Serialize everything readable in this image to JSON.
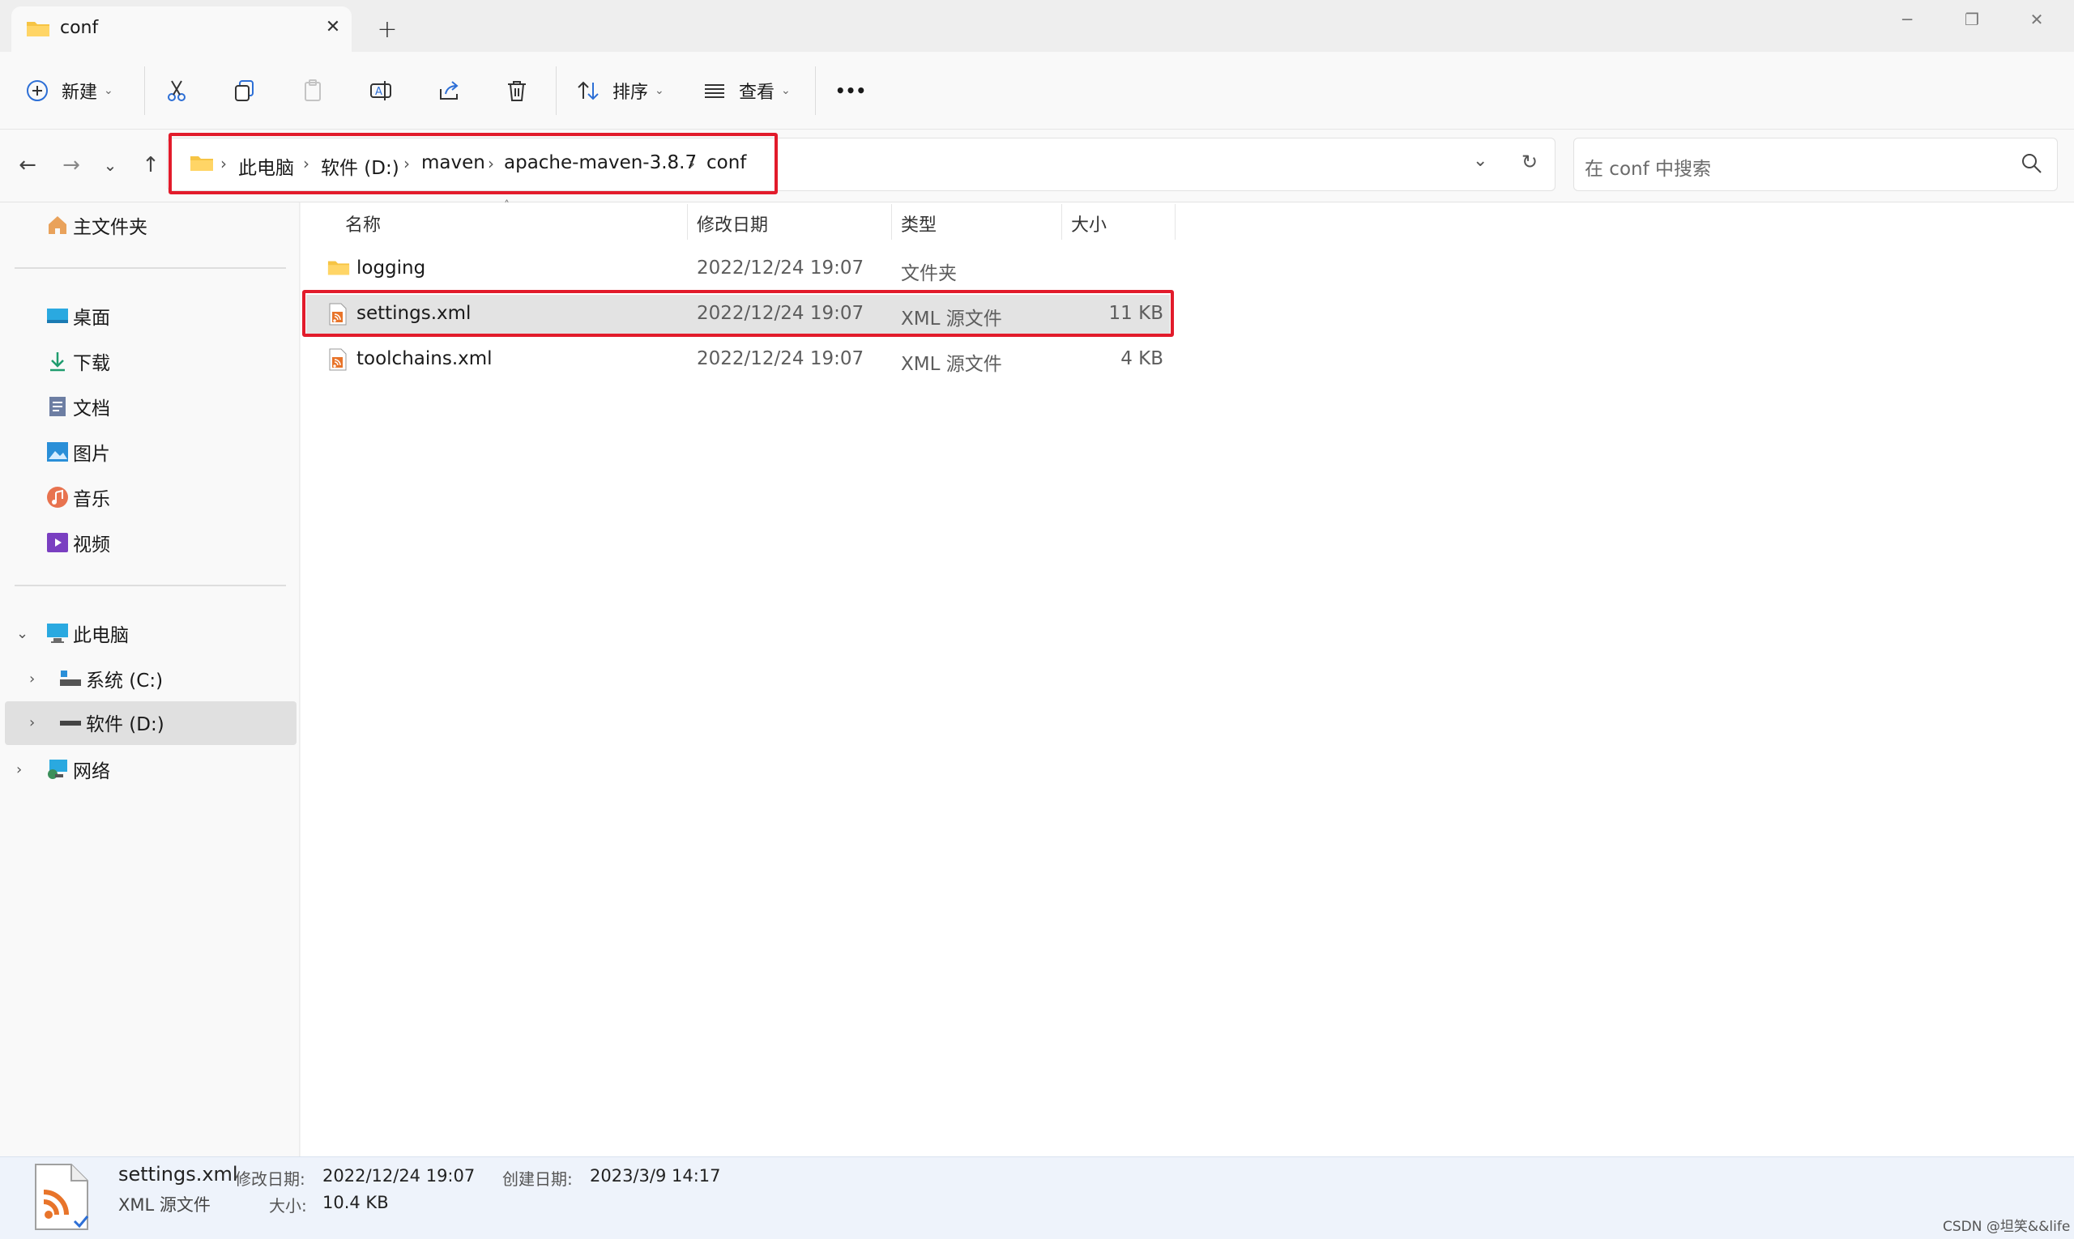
{
  "window": {
    "tab_title": "conf",
    "new_tab": "+",
    "tab_close": "✕",
    "minimize": "─",
    "restore": "❐",
    "close": "✕"
  },
  "toolbar": {
    "new_label": "新建",
    "sort_label": "排序",
    "view_label": "查看",
    "more_label": "•••"
  },
  "address": {
    "crumbs": [
      "此电脑",
      "软件 (D:)",
      "maven",
      "apache-maven-3.8.7",
      "conf"
    ],
    "sep": "›"
  },
  "search": {
    "placeholder": "在 conf 中搜索"
  },
  "sidebar": {
    "home": "主文件夹",
    "quick": [
      {
        "label": "桌面"
      },
      {
        "label": "下载"
      },
      {
        "label": "文档"
      },
      {
        "label": "图片"
      },
      {
        "label": "音乐"
      },
      {
        "label": "视频"
      }
    ],
    "this_pc": "此电脑",
    "drives": [
      {
        "label": "系统 (C:)"
      },
      {
        "label": "软件 (D:)"
      }
    ],
    "network": "网络"
  },
  "columns": {
    "name": "名称",
    "modified": "修改日期",
    "type": "类型",
    "size": "大小"
  },
  "files": [
    {
      "name": "logging",
      "modified": "2022/12/24 19:07",
      "type": "文件夹",
      "size": ""
    },
    {
      "name": "settings.xml",
      "modified": "2022/12/24 19:07",
      "type": "XML 源文件",
      "size": "11 KB"
    },
    {
      "name": "toolchains.xml",
      "modified": "2022/12/24 19:07",
      "type": "XML 源文件",
      "size": "4 KB"
    }
  ],
  "details": {
    "filename": "settings.xml",
    "type": "XML 源文件",
    "modified_label": "修改日期:",
    "modified_value": "2022/12/24 19:07",
    "size_label": "大小:",
    "size_value": "10.4 KB",
    "created_label": "创建日期:",
    "created_value": "2023/3/9 14:17"
  },
  "watermark": "CSDN @坦笑&&life",
  "colors": {
    "highlight_red": "#e21b2b",
    "folder_yellow": "#f6c444",
    "xml_orange": "#e8742a",
    "selection_gray": "#e3e3e3"
  }
}
